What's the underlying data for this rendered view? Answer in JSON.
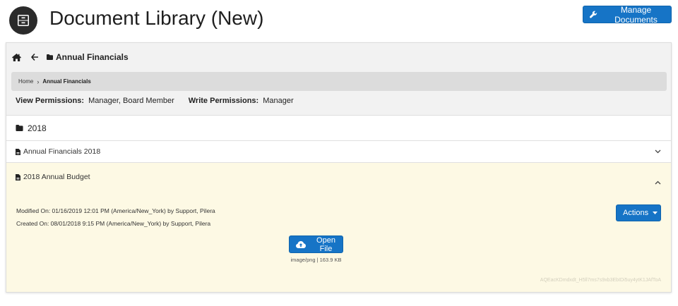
{
  "header": {
    "title": "Document Library (New)",
    "manage_button": "Manage Documents"
  },
  "nav": {
    "current_folder": "Annual Financials"
  },
  "breadcrumb": {
    "home": "Home",
    "separator": "›",
    "current": "Annual Financials"
  },
  "permissions": {
    "view_label": "View Permissions:",
    "view_value": "Manager, Board Member",
    "write_label": "Write Permissions:",
    "write_value": "Manager"
  },
  "folders": [
    {
      "label": "2018"
    }
  ],
  "documents": [
    {
      "label": "Annual Financials 2018",
      "expanded": false
    },
    {
      "label": "2018 Annual Budget",
      "expanded": true,
      "modified": "Modified On:  01/16/2019 12:01 PM (America/New_York) by  Support, Pilera",
      "created": "Created On:  08/01/2018 9:15 PM (America/New_York) by  Support, Pilera",
      "actions_label": "Actions",
      "open_label": "Open File",
      "file_meta": "image/png | 163.9 KB",
      "file_id": "AQEacKDmdxdt_H5ll7ms7s9xb3EbIDi5uy4ytK1JAfToA"
    }
  ],
  "icons": {
    "app": "archive-icon",
    "manage": "wrench-icon",
    "home": "home-icon",
    "back": "arrow-left-icon",
    "folder": "folder-icon",
    "document": "document-icon",
    "chevron_down": "chevron-down-icon",
    "chevron_up": "chevron-up-icon",
    "caret": "caret-down-icon",
    "upload": "cloud-upload-icon"
  },
  "colors": {
    "primary": "#1674c6",
    "expanded_bg": "#fdf9e4",
    "panel_head_bg": "#f2f2f2"
  }
}
